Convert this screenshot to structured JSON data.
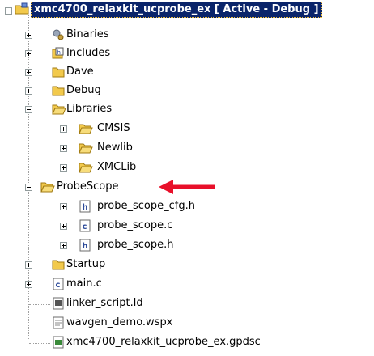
{
  "tree": {
    "project": {
      "label": "xmc4700_relaxkit_ucprobe_ex [ Active - Debug ]",
      "expanded": true
    },
    "items": [
      {
        "label": "Binaries",
        "icon": "binaries-icon",
        "expanded": false
      },
      {
        "label": "Includes",
        "icon": "includes-icon",
        "expanded": false
      },
      {
        "label": "Dave",
        "icon": "folder-icon",
        "expanded": false
      },
      {
        "label": "Debug",
        "icon": "folder-icon",
        "expanded": false
      },
      {
        "label": "Libraries",
        "icon": "folder-icon",
        "expanded": true,
        "children": [
          {
            "label": "CMSIS",
            "icon": "folder-icon",
            "expanded": false
          },
          {
            "label": "Newlib",
            "icon": "folder-icon",
            "expanded": false
          },
          {
            "label": "XMCLib",
            "icon": "folder-icon",
            "expanded": false
          }
        ]
      },
      {
        "label": "ProbeScope",
        "icon": "folder-icon",
        "expanded": true,
        "children": [
          {
            "label": "probe_scope_cfg.h",
            "icon": "h-file-icon",
            "expanded": false
          },
          {
            "label": "probe_scope.c",
            "icon": "c-file-icon",
            "expanded": false
          },
          {
            "label": "probe_scope.h",
            "icon": "h-file-icon",
            "expanded": false
          }
        ]
      },
      {
        "label": "Startup",
        "icon": "folder-icon",
        "expanded": false
      },
      {
        "label": "main.c",
        "icon": "c-file-icon",
        "expanded": false
      },
      {
        "label": "linker_script.ld",
        "icon": "ld-file-icon"
      },
      {
        "label": "wavgen_demo.wspx",
        "icon": "doc-file-icon"
      },
      {
        "label": "xmc4700_relaxkit_ucprobe_ex.gpdsc",
        "icon": "gpdsc-file-icon"
      }
    ]
  },
  "annotation": {
    "arrow_color": "#e8102a",
    "points_to": "ProbeScope"
  },
  "colors": {
    "selection": "#0a246a",
    "folder": "#f2c94c",
    "h_file": "#3b6fd6",
    "c_file": "#3b6fd6"
  }
}
